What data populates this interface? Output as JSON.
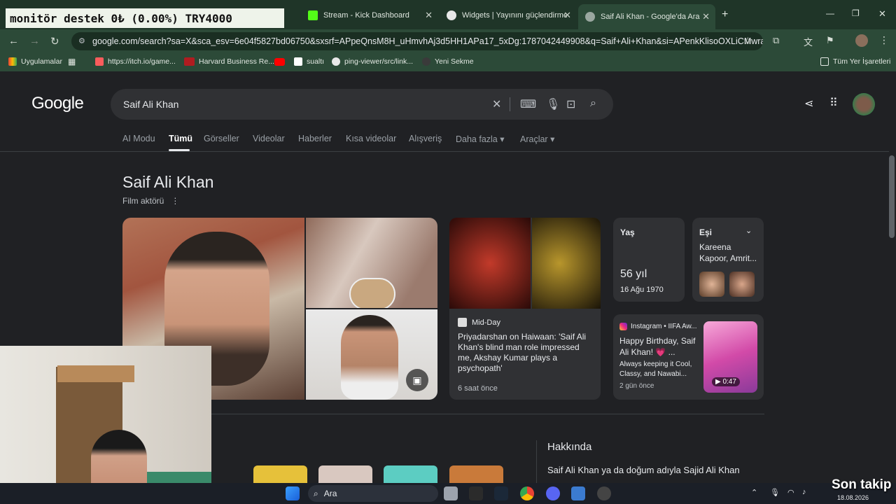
{
  "overlay": {
    "ticker": "monitör destek      0₺ (0.00%)          TRY4000"
  },
  "tabs": [
    {
      "label": "Stream - Kick Dashboard"
    },
    {
      "label": "Widgets | Yayınını güçlendirmek"
    },
    {
      "label": "Saif Ali Khan - Google'da Ara"
    }
  ],
  "address": {
    "url": "google.com/search?sa=X&sca_esv=6e04f5827bd06750&sxsrf=APpeQnsM8H_uHmvhAj3d5HH1APa17_5xDg:1787042449908&q=Saif+Ali+Khan&si=APenkKlisoOXLiCMwraINHtd..."
  },
  "bookmarks": [
    {
      "label": "Uygulamalar"
    },
    {
      "label": "https://itch.io/game..."
    },
    {
      "label": "Harvard Business Re..."
    },
    {
      "label": "sualtı"
    },
    {
      "label": "ping-viewer/src/link..."
    },
    {
      "label": "Yeni Sekme"
    }
  ],
  "bookmarks_right": "Tüm Yer İşaretleri",
  "google": {
    "logo": "Google",
    "query": "Saif Ali Khan",
    "tabs": [
      "AI Modu",
      "Tümü",
      "Görseller",
      "Videolar",
      "Haberler",
      "Kısa videolar",
      "Alışveriş",
      "Daha fazla ▾",
      "Araçlar ▾"
    ]
  },
  "entity": {
    "title": "Saif Ali Khan",
    "subtitle": "Film aktörü"
  },
  "news": {
    "source": "Mid-Day",
    "headline": "Priyadarshan on Haiwaan: 'Saif Ali Khan's blind man role impressed me, Akshay Kumar plays a psychopath'",
    "time": "6 saat önce"
  },
  "age_card": {
    "label": "Yaş",
    "value": "56 yıl",
    "date": "16 Ağu 1970"
  },
  "spouse_card": {
    "label": "Eşi",
    "value": "Kareena Kapoor, Amrit..."
  },
  "insta": {
    "source": "Instagram • IIFA Aw...",
    "title": "Happy Birthday, Saif Ali Khan! 💗 ...",
    "desc": "Always keeping it Cool, Classy, and Nawabi...",
    "time": "2 gün önce",
    "duration": "▶ 0:47"
  },
  "about": {
    "heading": "Hakkında",
    "text": "Saif Ali Khan ya da doğum adıyla Sajid Ali Khan"
  },
  "taskbar": {
    "search": "Ara",
    "time": "18.08.2026",
    "overlay_text": "Son takip"
  },
  "colors": {
    "accent": "#2c4a38",
    "page_bg": "#202124"
  }
}
